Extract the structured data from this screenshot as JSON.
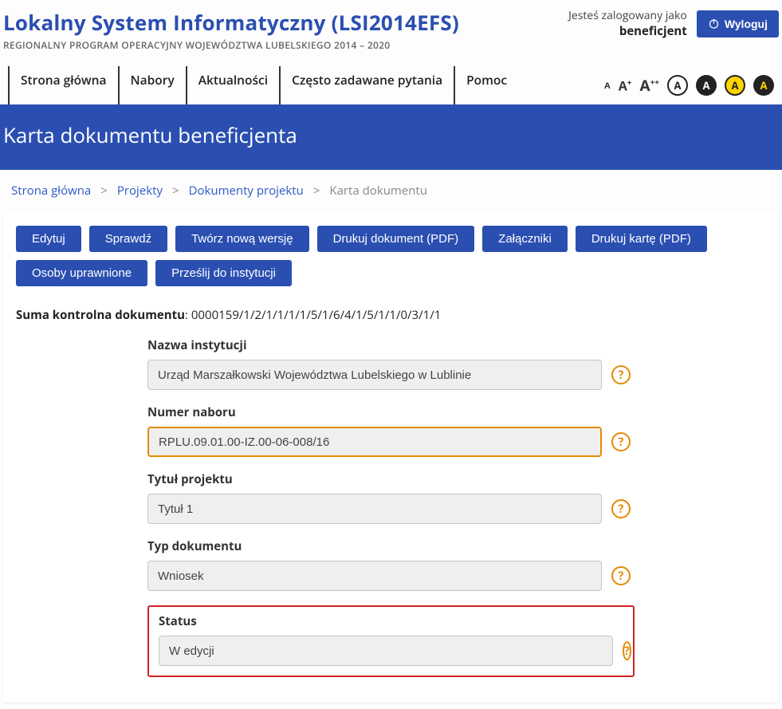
{
  "header": {
    "title": "Lokalny System Informatyczny (LSI2014EFS)",
    "subtitle": "REGIONALNY PROGRAM OPERACYJNY WOJEWÓDZTWA LUBELSKIEGO 2014 – 2020",
    "login_status": "Jesteś zalogowany jako",
    "login_user": "beneficjent",
    "logout": "Wyloguj"
  },
  "nav": {
    "items": [
      "Strona główna",
      "Nabory",
      "Aktualności",
      "Często zadawane pytania",
      "Pomoc"
    ]
  },
  "access": {
    "a": "A",
    "a_plus": "A",
    "a_plus_sup": "+",
    "a_pp": "A",
    "a_pp_sup": "++",
    "c1": "A",
    "c2": "A",
    "c3": "A",
    "c4": "A"
  },
  "page_title": "Karta dokumentu beneficjenta",
  "breadcrumbs": {
    "items": [
      "Strona główna",
      "Projekty",
      "Dokumenty projektu",
      "Karta dokumentu"
    ],
    "sep": ">"
  },
  "actions": {
    "row1": [
      "Edytuj",
      "Sprawdź",
      "Twórz nową wersję",
      "Drukuj dokument (PDF)",
      "Załączniki",
      "Drukuj kartę (PDF)"
    ],
    "row2": [
      "Osoby uprawnione",
      "Prześlij do instytucji"
    ]
  },
  "checksum": {
    "label": "Suma kontrolna dokumentu",
    "value": "0000159/1/2/1/1/1/1/5/1/6/4/1/5/1/1/0/3/1/1"
  },
  "fields": {
    "institution": {
      "label": "Nazwa instytucji",
      "value": "Urząd Marszałkowski Województwa Lubelskiego w Lublinie"
    },
    "recruitment_no": {
      "label": "Numer naboru",
      "value": "RPLU.09.01.00-IZ.00-06-008/16"
    },
    "project_title": {
      "label": "Tytuł projektu",
      "value": "Tytuł 1"
    },
    "doc_type": {
      "label": "Typ dokumentu",
      "value": "Wniosek"
    },
    "status": {
      "label": "Status",
      "value": "W edycji"
    }
  },
  "help": "?"
}
